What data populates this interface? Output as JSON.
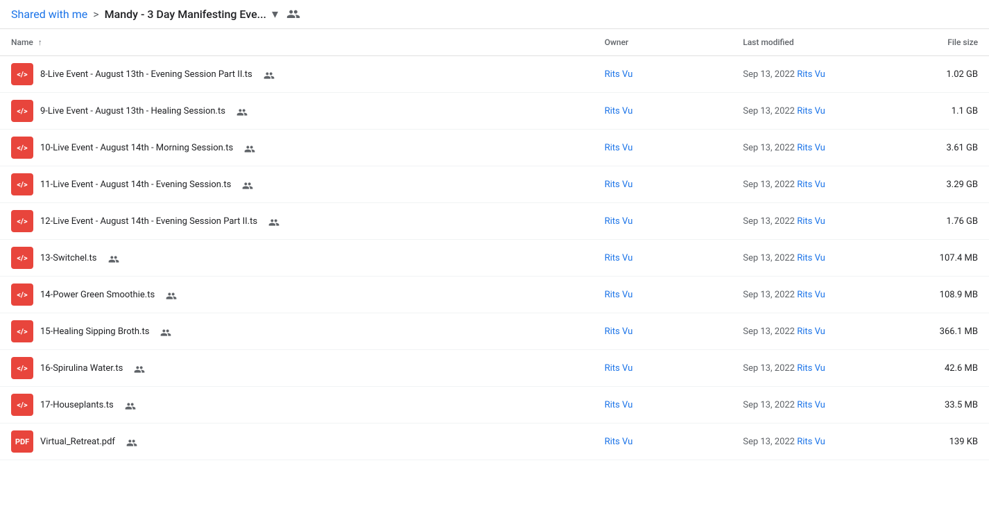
{
  "breadcrumb": {
    "shared_label": "Shared with me",
    "separator": ">",
    "folder_name": "Mandy - 3 Day Manifesting Eve...",
    "chevron": "▾"
  },
  "table": {
    "headers": {
      "name": "Name",
      "sort_icon": "↑",
      "owner": "Owner",
      "last_modified": "Last modified",
      "file_size": "File size"
    },
    "rows": [
      {
        "icon_type": "ts",
        "icon_label": "</>",
        "name": "8-Live Event - August 13th - Evening Session Part II.ts",
        "shared": true,
        "owner": "Rits Vu",
        "modified_date": "Sep 13, 2022",
        "modified_by": "Rits Vu",
        "size": "1.02 GB"
      },
      {
        "icon_type": "ts",
        "icon_label": "</>",
        "name": "9-Live Event - August 13th - Healing Session.ts",
        "shared": true,
        "owner": "Rits Vu",
        "modified_date": "Sep 13, 2022",
        "modified_by": "Rits Vu",
        "size": "1.1 GB"
      },
      {
        "icon_type": "ts",
        "icon_label": "</>",
        "name": "10-Live Event - August 14th - Morning Session.ts",
        "shared": true,
        "owner": "Rits Vu",
        "modified_date": "Sep 13, 2022",
        "modified_by": "Rits Vu",
        "size": "3.61 GB"
      },
      {
        "icon_type": "ts",
        "icon_label": "</>",
        "name": "11-Live Event - August 14th - Evening Session.ts",
        "shared": true,
        "owner": "Rits Vu",
        "modified_date": "Sep 13, 2022",
        "modified_by": "Rits Vu",
        "size": "3.29 GB"
      },
      {
        "icon_type": "ts",
        "icon_label": "</>",
        "name": "12-Live Event - August 14th - Evening Session Part II.ts",
        "shared": true,
        "owner": "Rits Vu",
        "modified_date": "Sep 13, 2022",
        "modified_by": "Rits Vu",
        "size": "1.76 GB"
      },
      {
        "icon_type": "ts",
        "icon_label": "</>",
        "name": "13-Switchel.ts",
        "shared": true,
        "owner": "Rits Vu",
        "modified_date": "Sep 13, 2022",
        "modified_by": "Rits Vu",
        "size": "107.4 MB"
      },
      {
        "icon_type": "ts",
        "icon_label": "</>",
        "name": "14-Power Green Smoothie.ts",
        "shared": true,
        "owner": "Rits Vu",
        "modified_date": "Sep 13, 2022",
        "modified_by": "Rits Vu",
        "size": "108.9 MB"
      },
      {
        "icon_type": "ts",
        "icon_label": "</>",
        "name": "15-Healing Sipping Broth.ts",
        "shared": true,
        "owner": "Rits Vu",
        "modified_date": "Sep 13, 2022",
        "modified_by": "Rits Vu",
        "size": "366.1 MB"
      },
      {
        "icon_type": "ts",
        "icon_label": "</>",
        "name": "16-Spirulina Water.ts",
        "shared": true,
        "owner": "Rits Vu",
        "modified_date": "Sep 13, 2022",
        "modified_by": "Rits Vu",
        "size": "42.6 MB"
      },
      {
        "icon_type": "ts",
        "icon_label": "</>",
        "name": "17-Houseplants.ts",
        "shared": true,
        "owner": "Rits Vu",
        "modified_date": "Sep 13, 2022",
        "modified_by": "Rits Vu",
        "size": "33.5 MB"
      },
      {
        "icon_type": "pdf",
        "icon_label": "PDF",
        "name": "Virtual_Retreat.pdf",
        "shared": true,
        "owner": "Rits Vu",
        "modified_date": "Sep 13, 2022",
        "modified_by": "Rits Vu",
        "size": "139 KB"
      }
    ]
  }
}
